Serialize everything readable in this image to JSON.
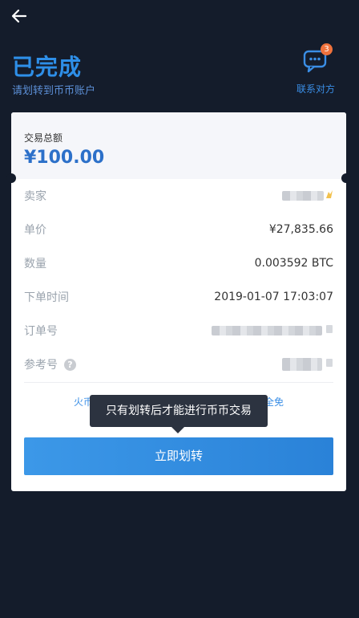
{
  "header": {
    "title": "已完成",
    "subtitle": "请划转到币币账户",
    "contact_label": "联系对方",
    "contact_badge": "3"
  },
  "card": {
    "total_label": "交易总额",
    "total_amount": "¥100.00",
    "rows": [
      {
        "label": "卖家",
        "value": ""
      },
      {
        "label": "单价",
        "value": "¥27,835.66"
      },
      {
        "label": "数量",
        "value": "0.003592 BTC"
      },
      {
        "label": "下单时间",
        "value": "2019-01-07 17:03:07"
      },
      {
        "label": "订单号",
        "value": ""
      },
      {
        "label": "参考号",
        "value": ""
      }
    ],
    "notice_left": "火币",
    "notice_right": "全免",
    "tooltip": "只有划转后才能进行币币交易",
    "transfer_button": "立即划转"
  },
  "colors": {
    "background": "#141c2b",
    "accent": "#2e8fe8",
    "badge": "#f0723c"
  },
  "icons": [
    "back-arrow-icon",
    "chat-icon",
    "help-icon",
    "copy-icon",
    "crown-icon"
  ]
}
